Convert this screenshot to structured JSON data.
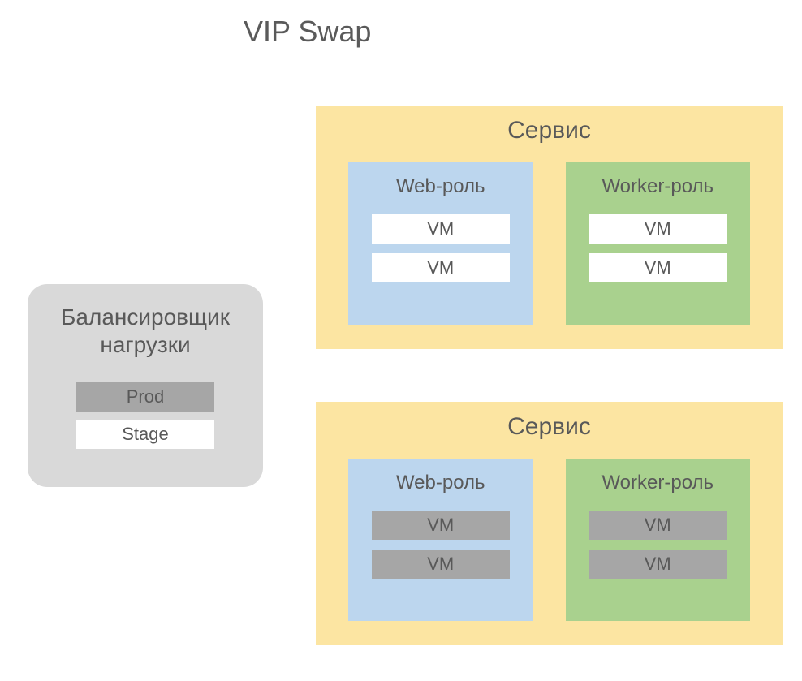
{
  "title": "VIP Swap",
  "balancer": {
    "title": "Балансировщик нагрузки",
    "slots": {
      "prod": "Prod",
      "stage": "Stage"
    }
  },
  "services": {
    "top": {
      "title": "Сервис",
      "web": {
        "title": "Web-роль",
        "vms": {
          "vm1": "VM",
          "vm2": "VM"
        }
      },
      "worker": {
        "title": "Worker-роль",
        "vms": {
          "vm1": "VM",
          "vm2": "VM"
        }
      }
    },
    "bottom": {
      "title": "Сервис",
      "web": {
        "title": "Web-роль",
        "vms": {
          "vm1": "VM",
          "vm2": "VM"
        }
      },
      "worker": {
        "title": "Worker-роль",
        "vms": {
          "vm1": "VM",
          "vm2": "VM"
        }
      }
    }
  }
}
